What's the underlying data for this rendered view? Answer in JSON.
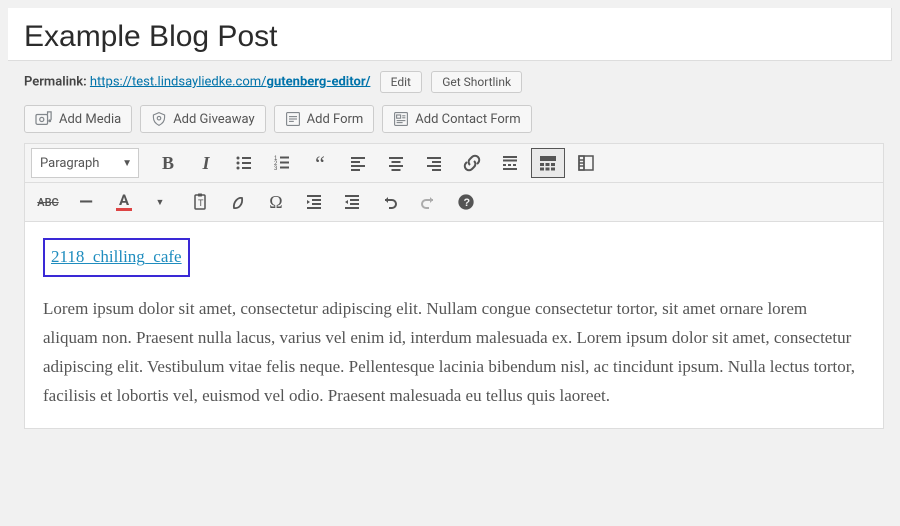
{
  "post": {
    "title": "Example Blog Post"
  },
  "permalink": {
    "label": "Permalink:",
    "base": "https://test.lindsayliedke.com/",
    "slug": "gutenberg-editor/",
    "edit_label": "Edit",
    "shortlink_label": "Get Shortlink"
  },
  "media_buttons": {
    "add_media": "Add Media",
    "add_giveaway": "Add Giveaway",
    "add_form": "Add Form",
    "add_contact_form": "Add Contact Form"
  },
  "toolbar": {
    "format": "Paragraph"
  },
  "content": {
    "link_text": "2118_chilling_cafe",
    "body": "Lorem ipsum dolor sit amet, consectetur adipiscing elit. Nullam congue consectetur tortor, sit amet ornare lorem aliquam non. Praesent nulla lacus, varius vel enim id, interdum malesuada ex. Lorem ipsum dolor sit amet, consectetur adipiscing elit. Vestibulum vitae felis neque. Pellentesque lacinia bibendum nisl, ac tincidunt ipsum. Nulla lectus tortor, facilisis et lobortis vel, euismod vel odio. Praesent malesuada eu tellus quis laoreet."
  }
}
